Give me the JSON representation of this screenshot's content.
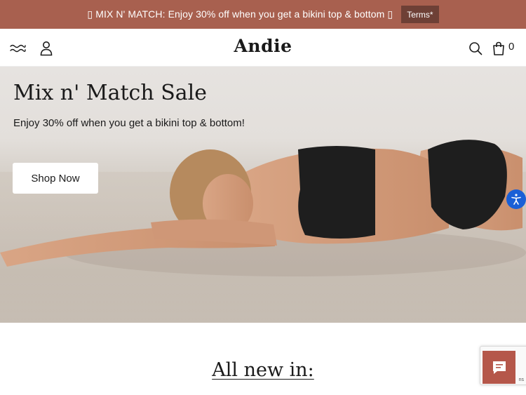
{
  "promo": {
    "text": "▯ MIX N' MATCH: Enjoy 30% off when you get a bikini top & bottom ▯",
    "terms_label": "Terms*"
  },
  "header": {
    "logo": "Andie",
    "cart_count": "0",
    "icons": [
      "menu-waves-icon",
      "account-icon",
      "search-icon",
      "cart-bag-icon"
    ]
  },
  "hero": {
    "title": "Mix n' Match Sale",
    "subtitle": "Enjoy 30% off when you get a bikini top & bottom!",
    "cta_label": "Shop Now"
  },
  "section": {
    "title": "All new in:"
  },
  "widgets": {
    "recaptcha_text": "ns",
    "accessibility_icon": "accessibility-icon",
    "chat_icon": "chat-icon"
  },
  "colors": {
    "promo_bg": "#a8604f",
    "terms_bg": "#6e4036",
    "chat_bg": "#b5574a",
    "accessibility_bg": "#1a5fd6",
    "text": "#1a1a1a"
  }
}
